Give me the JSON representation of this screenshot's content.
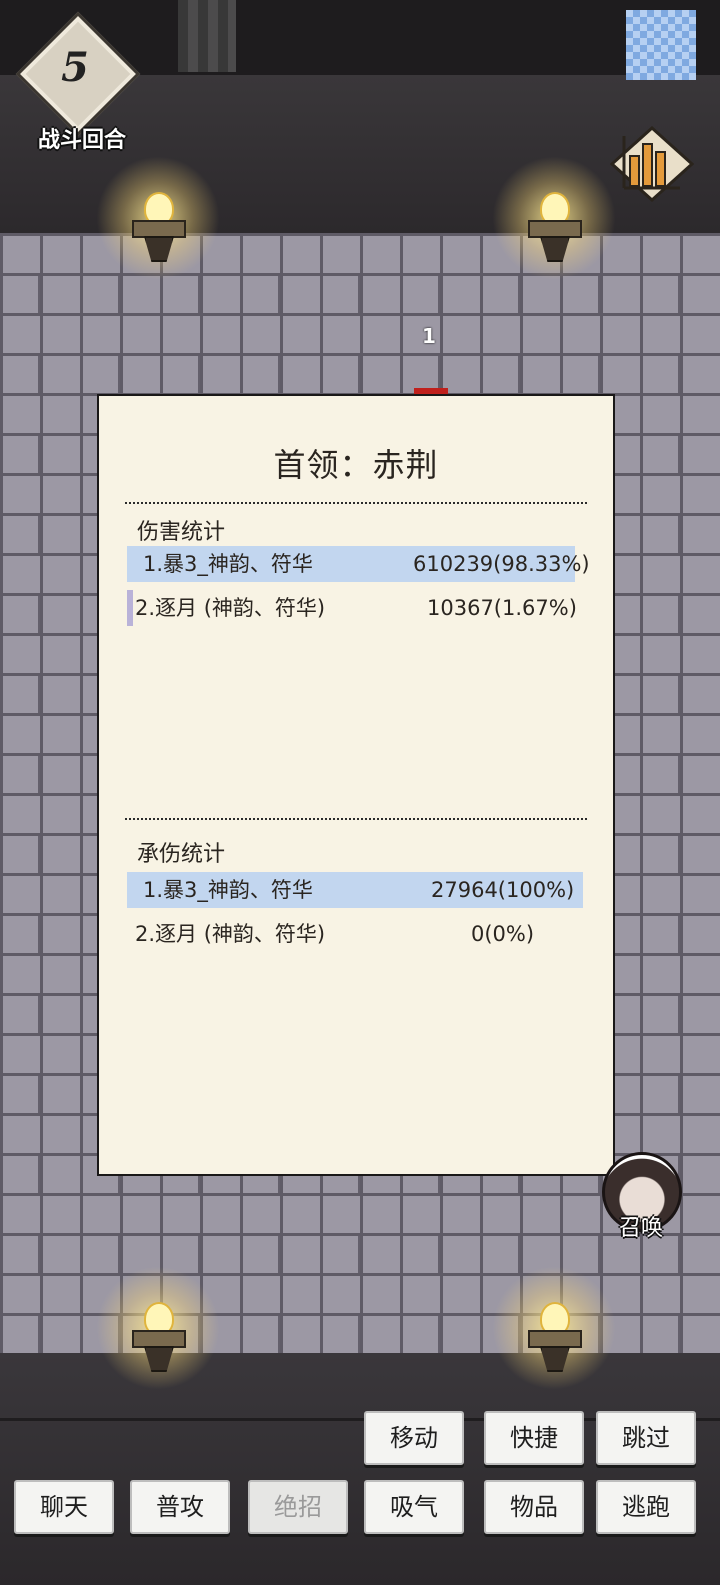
{
  "hud": {
    "round_number": "5",
    "round_label": "战斗回合",
    "floating_damage": "1"
  },
  "stats_panel": {
    "title": "首领：赤荆",
    "damage_section": {
      "label": "伤害统计",
      "rows": [
        {
          "name": "1.暴3_神韵、符华",
          "value": "610239(98.33%)",
          "share": 0.9833
        },
        {
          "name": "2.逐月 (神韵、符华)",
          "value": "10367(1.67%)",
          "share": 0.0167
        }
      ]
    },
    "taken_section": {
      "label": "承伤统计",
      "rows": [
        {
          "name": "1.暴3_神韵、符华",
          "value": "27964(100%)",
          "share": 1.0
        },
        {
          "name": "2.逐月 (神韵、符华)",
          "value": "0(0%)",
          "share": 0
        }
      ]
    }
  },
  "summon": {
    "label": "召唤"
  },
  "actions": {
    "move": "移动",
    "shortcut": "快捷",
    "skip": "跳过",
    "chat": "聊天",
    "attack": "普攻",
    "ultimate": "绝招",
    "breathe": "吸气",
    "items": "物品",
    "flee": "逃跑"
  },
  "colors": {
    "bar_fill": "#c2d6ef",
    "small_bar_fill": "#b9b2d8",
    "panel_bg": "#f8f3e4"
  }
}
